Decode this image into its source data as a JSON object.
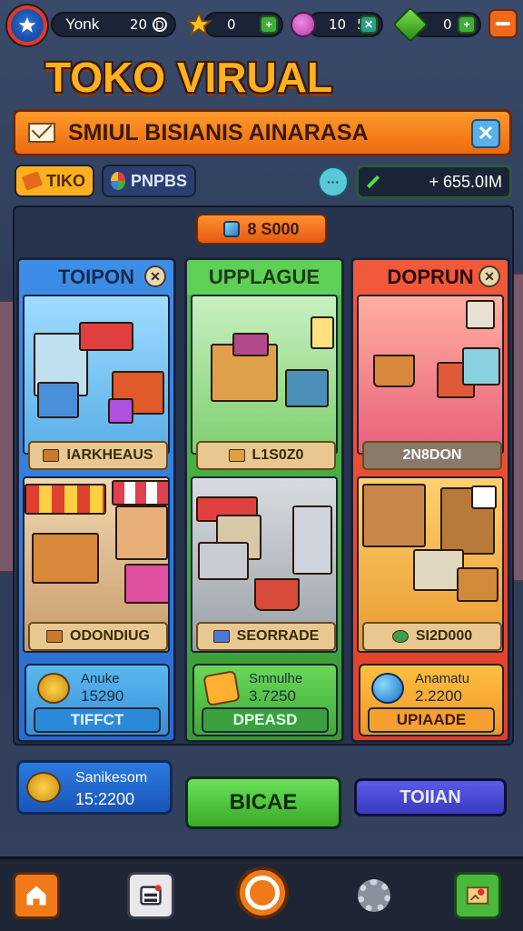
{
  "topbar": {
    "player_name": "Yonk",
    "player_value": "20",
    "stars": "0",
    "potions": "10",
    "potions_secondary": "5",
    "gems": "0"
  },
  "title": "TOKO VIRUAL",
  "subtitle": "SMIUL BISIANIS AINARASA",
  "tabs": {
    "toko": "TIKO",
    "pnpbs": "PNPBS"
  },
  "money": "+ 655.0IM",
  "cost_badge": "8 S000",
  "columns": [
    {
      "header": "TOIPON",
      "label1": "IARKHEAUS",
      "label2": "ODONDIUG",
      "info_name": "Anuke",
      "info_value": "15290",
      "button": "TIFFCT"
    },
    {
      "header": "UPPLAGUE",
      "label1": "L1S0Z0",
      "label2": "SEORRADE",
      "info_name": "Smnulhe",
      "info_value": "3.7250",
      "button": "DPEASD"
    },
    {
      "header": "DOPRUN",
      "label1": "2N8DON",
      "label2": "SI2D000",
      "info_name": "Anamatu",
      "info_value": "2.2200",
      "button": "UPIAADE"
    }
  ],
  "bank": {
    "name": "Sanikesom",
    "value": "15:2200"
  },
  "actions": {
    "green": "BICAE",
    "purple": "TOIIAN"
  },
  "colors": {
    "accent_orange": "#f07a1a",
    "title_gold": "#ffb21e",
    "blue_column": "#2a6bd0",
    "green_column": "#3a9a36",
    "red_column": "#e0402a"
  },
  "icons": {
    "avatar": "star-icon",
    "stars": "star-icon",
    "potion": "potion-icon",
    "gem": "gem-icon",
    "menu": "menu-icon",
    "envelope": "envelope-icon",
    "close": "close-icon",
    "home": "home-icon",
    "list": "list-icon",
    "settings": "gear-icon",
    "map": "map-icon"
  }
}
